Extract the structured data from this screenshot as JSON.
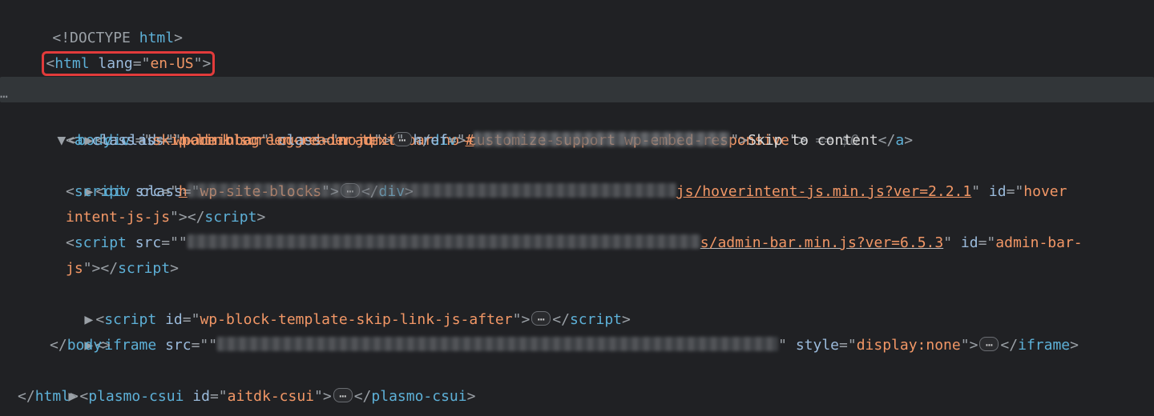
{
  "lines": {
    "doctype": {
      "open": "<!DOCTYPE ",
      "name": "html",
      "close": ">"
    },
    "html": {
      "open": "<",
      "tag": "html",
      "sp": " ",
      "attr": "lang",
      "eq": "=\"",
      "val": "en-US",
      "cq": "\"",
      "gt": ">"
    },
    "head": {
      "open": "<",
      "tag": "head",
      "gt": ">",
      "ctag": "</",
      "ctagn": "head",
      "cgt": ">"
    },
    "body": {
      "open": "<",
      "tag": "body",
      "sp": " ",
      "attr": "class",
      "eq": "=\"",
      "val": "home blog logged-in admin-bar no-customize-support wp-embed-responsive",
      "cq": "\"",
      "gt": ">",
      "tail": " == $0"
    },
    "div1": {
      "open": "<",
      "tag": "div",
      "sp": " ",
      "a1": "id",
      "eq1": "=\"",
      "v1": "wpadminbar",
      "cq1": "\" ",
      "a2": "class",
      "eq2": "=\"",
      "v2": "nojq",
      "cq2": "\"",
      "gt": ">",
      "co": "</",
      "ctag": "div",
      "cgt": ">"
    },
    "a": {
      "open": "<",
      "tag": "a",
      "sp": " ",
      "a1": "class",
      "eq1": "=\"",
      "v1": "skip-link screen-reader-text",
      "cq1": "\" ",
      "a2": "href",
      "eq2": "=\"",
      "v2a": "#",
      "cq2": "\"",
      "gt": ">",
      "text": "Skip to content",
      "co": "</",
      "ctag": "a",
      "cgt": ">"
    },
    "div2": {
      "open": "<",
      "tag": "div",
      "sp": " ",
      "a1": "class",
      "eq1": "=\"",
      "v1": "wp-site-blocks",
      "cq1": "\"",
      "gt": ">",
      "co": "</",
      "ctag": "div",
      "cgt": ">"
    },
    "script1": {
      "open": "<",
      "tag": "script",
      "sp": " ",
      "a1": "src",
      "eq1": "=\"",
      "v1a": "h",
      "v1b": "js/hoverintent-js.min.js?ver=2.2.1",
      "cq1": "\" ",
      "a2": "id",
      "eq2": "=\"",
      "v2a": "hover",
      "v2b": "intent-js-js",
      "cq2b": "\"",
      "mid": ">",
      "co": "</",
      "ctag": "script",
      "cgt": ">"
    },
    "script2": {
      "open": "<",
      "tag": "script",
      "sp": " ",
      "a1": "src",
      "eq1": "=\"",
      "v1b": "s/admin-bar.min.js?ver=6.5.3",
      "cq1": "\" ",
      "a2": "id",
      "eq2": "=\"",
      "v2a": "admin-bar-",
      "v2b": "js",
      "cq2b": "\"",
      "mid": ">",
      "co": "</",
      "ctag": "script",
      "cgt": ">"
    },
    "script3": {
      "open": "<",
      "tag": "script",
      "sp": " ",
      "a1": "id",
      "eq1": "=\"",
      "v1": "wp-block-template-skip-link-js-after",
      "cq1": "\"",
      "gt": ">",
      "co": "</",
      "ctag": "script",
      "cgt": ">"
    },
    "iframe": {
      "open": "<",
      "tag": "iframe",
      "sp": " ",
      "a1": "src",
      "eq1": "=\"",
      "cq1": "\" ",
      "a2": "style",
      "eq2": "=\"",
      "v2": "display:none",
      "cq2": "\"",
      "gt": ">",
      "co": "</",
      "ctag": "iframe",
      "cgt": ">"
    },
    "bodyclose": {
      "open": "</",
      "tag": "body",
      "gt": ">"
    },
    "plasmo": {
      "open": "<",
      "tag": "plasmo-csui",
      "sp": " ",
      "a1": "id",
      "eq1": "=\"",
      "v1": "aitdk-csui",
      "cq1": "\"",
      "gt": ">",
      "co": "</",
      "ctag": "plasmo-csui",
      "cgt": ">"
    },
    "htmlclose": {
      "open": "</",
      "tag": "html",
      "gt": ">"
    }
  }
}
